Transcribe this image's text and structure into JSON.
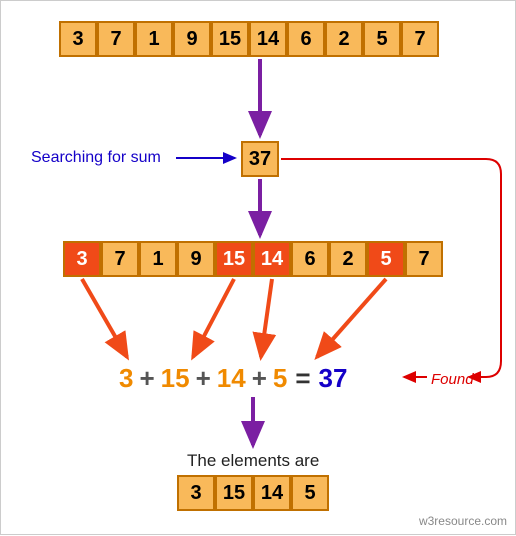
{
  "array1": [
    "3",
    "7",
    "1",
    "9",
    "15",
    "14",
    "6",
    "2",
    "5",
    "7"
  ],
  "target_label": "Searching for sum",
  "target_value": "37",
  "array2": {
    "values": [
      "3",
      "7",
      "1",
      "9",
      "15",
      "14",
      "6",
      "2",
      "5",
      "7"
    ],
    "highlighted": [
      0,
      4,
      5,
      8
    ]
  },
  "equation": {
    "terms": [
      "3",
      "15",
      "14",
      "5"
    ],
    "result": "37"
  },
  "found_label": "Found",
  "result_header": "The elements are",
  "result_array": [
    "3",
    "15",
    "14",
    "5"
  ],
  "credit": "w3resource.com",
  "chart_data": {
    "type": "table",
    "title": "Find elements whose sum equals target",
    "input_array": [
      3,
      7,
      1,
      9,
      15,
      14,
      6,
      2,
      5,
      7
    ],
    "target_sum": 37,
    "selected_indices": [
      0,
      4,
      5,
      8
    ],
    "selected_values": [
      3,
      15,
      14,
      5
    ],
    "equation": "3 + 15 + 14 + 5 = 37",
    "result_elements": [
      3,
      15,
      14,
      5
    ]
  }
}
